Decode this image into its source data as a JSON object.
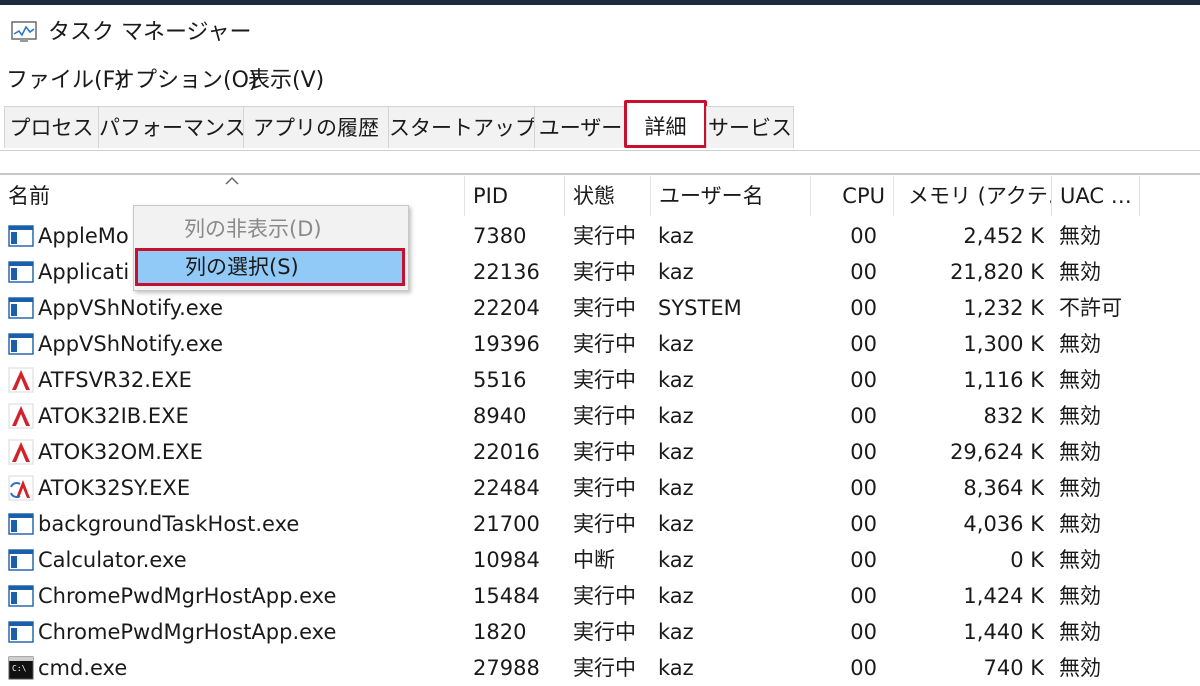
{
  "window": {
    "title": "タスク マネージャー",
    "app_icon": "task-manager-icon"
  },
  "menu": [
    "ファイル(F)",
    "オプション(O)",
    "表示(V)"
  ],
  "tabs": [
    {
      "label": "プロセス",
      "active": false
    },
    {
      "label": "パフォーマンス",
      "active": false
    },
    {
      "label": "アプリの履歴",
      "active": false
    },
    {
      "label": "スタートアップ",
      "active": false
    },
    {
      "label": "ユーザー",
      "active": false
    },
    {
      "label": "詳細",
      "active": true
    },
    {
      "label": "サービス",
      "active": false
    }
  ],
  "columns": {
    "name": "名前",
    "pid": "PID",
    "status": "状態",
    "user": "ユーザー名",
    "cpu": "CPU",
    "memory": "メモリ (アクテ…",
    "uac": "UAC …"
  },
  "context_menu": {
    "items": [
      {
        "label": "列の非表示(D)",
        "disabled": true
      },
      {
        "label": "列の選択(S)",
        "selected": true
      }
    ]
  },
  "processes": [
    {
      "name": "AppleMo",
      "pid": "7380",
      "status": "実行中",
      "user": "kaz",
      "cpu": "00",
      "memory": "2,452 K",
      "uac": "無効",
      "icon": "window-icon"
    },
    {
      "name": "Applicati",
      "pid": "22136",
      "status": "実行中",
      "user": "kaz",
      "cpu": "00",
      "memory": "21,820 K",
      "uac": "無効",
      "icon": "window-icon"
    },
    {
      "name": "AppVShNotify.exe",
      "pid": "22204",
      "status": "実行中",
      "user": "SYSTEM",
      "cpu": "00",
      "memory": "1,232 K",
      "uac": "不許可",
      "icon": "window-icon"
    },
    {
      "name": "AppVShNotify.exe",
      "pid": "19396",
      "status": "実行中",
      "user": "kaz",
      "cpu": "00",
      "memory": "1,300 K",
      "uac": "無効",
      "icon": "window-icon"
    },
    {
      "name": "ATFSVR32.EXE",
      "pid": "5516",
      "status": "実行中",
      "user": "kaz",
      "cpu": "00",
      "memory": "1,116 K",
      "uac": "無効",
      "icon": "atok-icon"
    },
    {
      "name": "ATOK32IB.EXE",
      "pid": "8940",
      "status": "実行中",
      "user": "kaz",
      "cpu": "00",
      "memory": "832 K",
      "uac": "無効",
      "icon": "atok-icon"
    },
    {
      "name": "ATOK32OM.EXE",
      "pid": "22016",
      "status": "実行中",
      "user": "kaz",
      "cpu": "00",
      "memory": "29,624 K",
      "uac": "無効",
      "icon": "atok-icon"
    },
    {
      "name": "ATOK32SY.EXE",
      "pid": "22484",
      "status": "実行中",
      "user": "kaz",
      "cpu": "00",
      "memory": "8,364 K",
      "uac": "無効",
      "icon": "atok-sync-icon"
    },
    {
      "name": "backgroundTaskHost.exe",
      "pid": "21700",
      "status": "実行中",
      "user": "kaz",
      "cpu": "00",
      "memory": "4,036 K",
      "uac": "無効",
      "icon": "window-icon"
    },
    {
      "name": "Calculator.exe",
      "pid": "10984",
      "status": "中断",
      "user": "kaz",
      "cpu": "00",
      "memory": "0 K",
      "uac": "無効",
      "icon": "window-icon"
    },
    {
      "name": "ChromePwdMgrHostApp.exe",
      "pid": "15484",
      "status": "実行中",
      "user": "kaz",
      "cpu": "00",
      "memory": "1,424 K",
      "uac": "無効",
      "icon": "window-icon"
    },
    {
      "name": "ChromePwdMgrHostApp.exe",
      "pid": "1820",
      "status": "実行中",
      "user": "kaz",
      "cpu": "00",
      "memory": "1,440 K",
      "uac": "無効",
      "icon": "window-icon"
    },
    {
      "name": "cmd.exe",
      "pid": "27988",
      "status": "実行中",
      "user": "kaz",
      "cpu": "00",
      "memory": "740 K",
      "uac": "無効",
      "icon": "console-icon"
    }
  ],
  "colors": {
    "highlight_border": "#c8102e",
    "menu_selection": "#91c9f7"
  }
}
